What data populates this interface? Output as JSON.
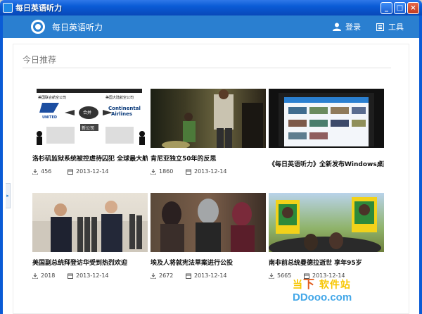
{
  "window": {
    "title": "每日英语听力",
    "min_label": "_",
    "max_label": "□",
    "close_label": "×"
  },
  "header": {
    "app_name": "每日英语听力",
    "login_label": "登录",
    "tools_label": "工具"
  },
  "section": {
    "title": "今日推荐"
  },
  "side_tab_glyph": "▸",
  "cards": [
    {
      "title": "洛杉矶监狱系统被控虐待囚犯 全球最大航空",
      "plays": "456",
      "date": "2013-12-14",
      "thumb_texts": [
        "美国联合航空公司",
        "美国大陆航空公司",
        "Continental",
        "Airlines",
        "UNITED",
        "合并",
        "新公司"
      ]
    },
    {
      "title": "肯尼亚独立50年的反思",
      "plays": "1860",
      "date": "2013-12-14",
      "thumb_texts": []
    },
    {
      "title": "《每日英语听力》全新发布Windows桌面版",
      "plays": "",
      "date": "",
      "thumb_texts": []
    },
    {
      "title": "美国副总统拜登访华受到热烈欢迎",
      "plays": "2018",
      "date": "2013-12-14",
      "thumb_texts": []
    },
    {
      "title": "埃及人将就宪法草案进行公投",
      "plays": "2672",
      "date": "2013-12-14",
      "thumb_texts": []
    },
    {
      "title": "南非前总统曼德拉逝世 享年95岁",
      "plays": "5665",
      "date": "2013-12-14",
      "thumb_texts": []
    }
  ],
  "watermark": {
    "brand_left": "当",
    "brand_mid": "下",
    "brand_right": "软件站",
    "url": "DDooo.com"
  }
}
